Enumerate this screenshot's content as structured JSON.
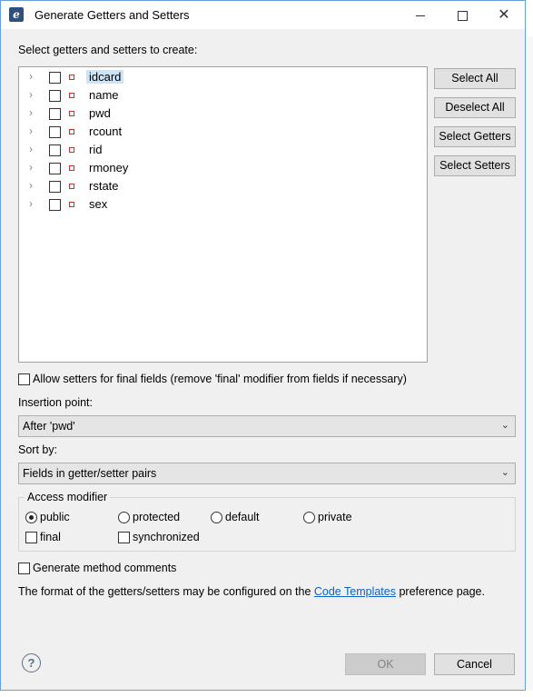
{
  "window": {
    "title": "Generate Getters and Setters"
  },
  "labels": {
    "select_prompt": "Select getters and setters to create:",
    "insertion_point": "Insertion point:",
    "sort_by": "Sort by:",
    "format_prefix": "The format of the getters/setters may be configured on the ",
    "format_link": "Code Templates",
    "format_suffix": " preference page."
  },
  "fields": [
    {
      "name": "idcard",
      "checked": false,
      "selected": true
    },
    {
      "name": "name",
      "checked": false,
      "selected": false
    },
    {
      "name": "pwd",
      "checked": false,
      "selected": false
    },
    {
      "name": "rcount",
      "checked": false,
      "selected": false
    },
    {
      "name": "rid",
      "checked": false,
      "selected": false
    },
    {
      "name": "rmoney",
      "checked": false,
      "selected": false
    },
    {
      "name": "rstate",
      "checked": false,
      "selected": false
    },
    {
      "name": "sex",
      "checked": false,
      "selected": false
    }
  ],
  "buttons": {
    "select_all": "Select All",
    "deselect_all": "Deselect All",
    "select_getters": "Select Getters",
    "select_setters": "Select Setters",
    "ok": "OK",
    "cancel": "Cancel"
  },
  "options": {
    "allow_final_setters": "Allow setters for final fields (remove 'final' modifier from fields if necessary)",
    "insertion_point_value": "After 'pwd'",
    "sort_by_value": "Fields in getter/setter pairs",
    "generate_comments": "Generate method comments"
  },
  "access_modifier": {
    "title": "Access modifier",
    "radios": [
      "public",
      "protected",
      "default",
      "private"
    ],
    "selected": "public",
    "final": "final",
    "synchronized": "synchronized"
  },
  "icons": {
    "app": "eclipse-icon",
    "help": "help-icon",
    "field": "private-field-icon"
  },
  "colors": {
    "accent_border": "#6a9fd6",
    "link": "#0b62c4",
    "field_icon": "#c83030"
  }
}
